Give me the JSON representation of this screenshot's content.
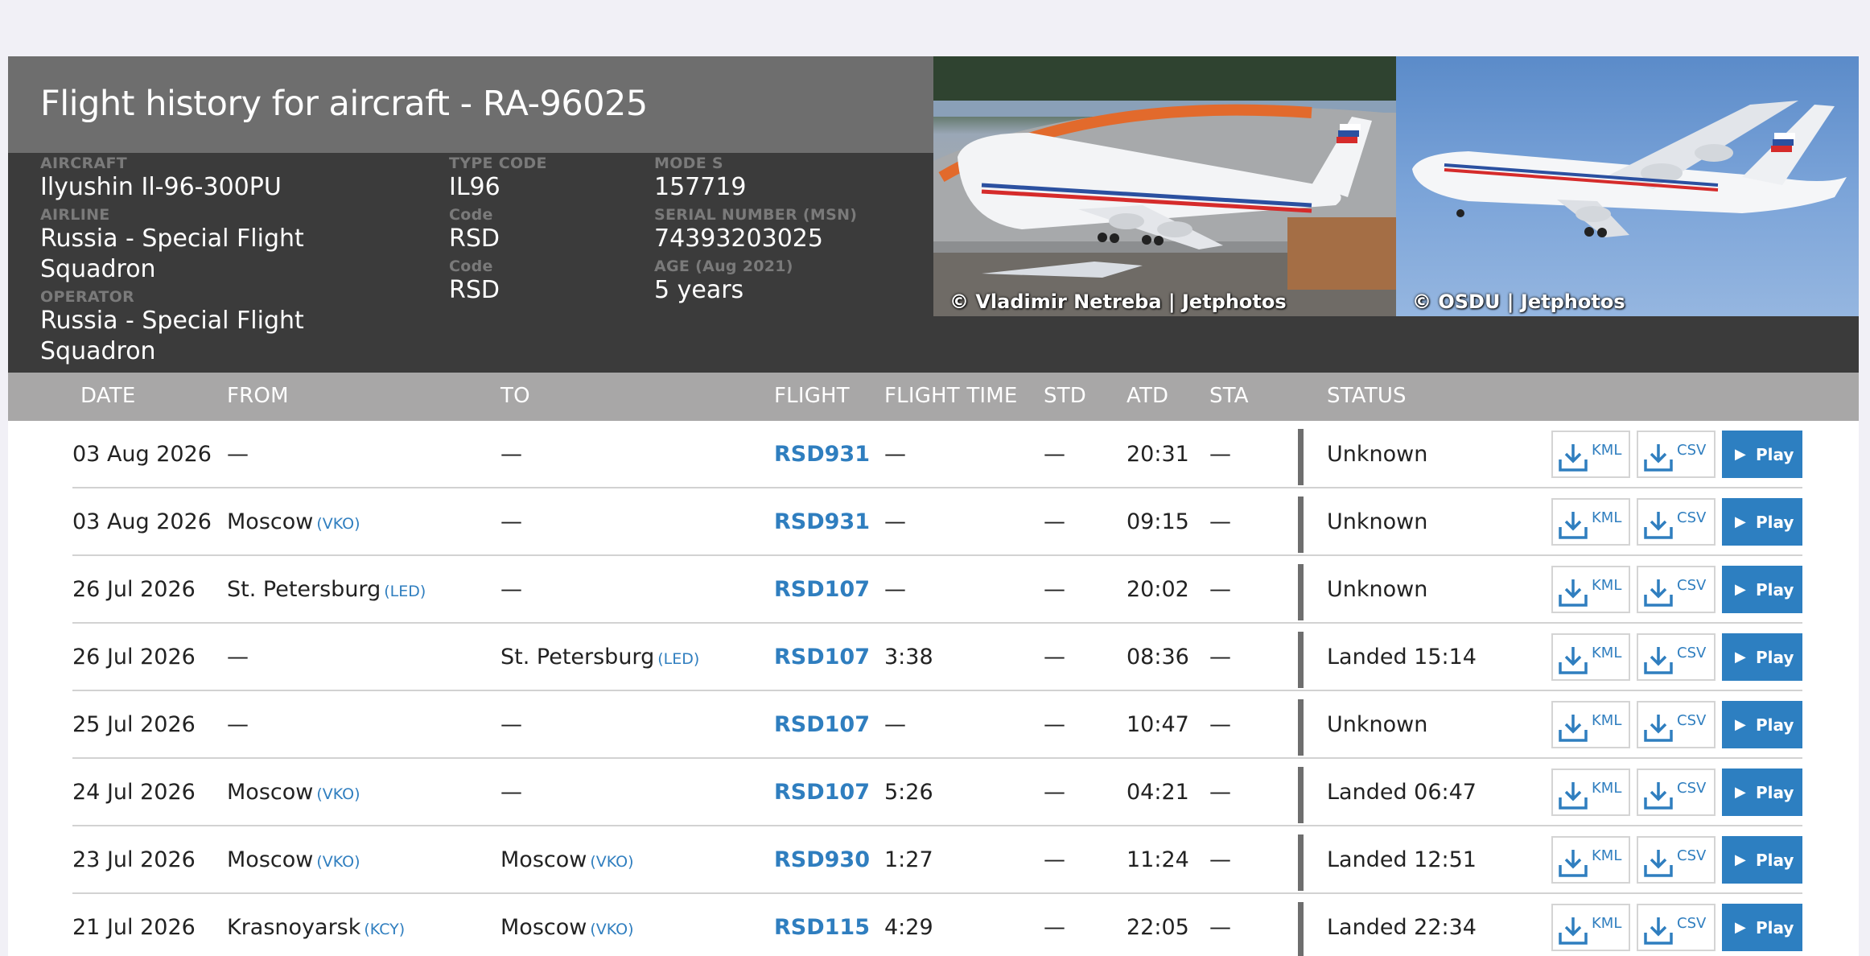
{
  "header": {
    "title": "Flight history for aircraft - RA-96025",
    "aircraft_label": "AIRCRAFT",
    "aircraft": "Ilyushin Il-96-300PU",
    "airline_label": "AIRLINE",
    "airline": "Russia - Special Flight Squadron",
    "operator_label": "OPERATOR",
    "operator": "Russia - Special Flight Squadron",
    "type_code_label": "TYPE CODE",
    "type_code": "IL96",
    "code_label_1": "Code",
    "code_1": "RSD",
    "code_label_2": "Code",
    "code_2": "RSD",
    "mode_s_label": "MODE S",
    "mode_s": "157719",
    "serial_label": "SERIAL NUMBER (MSN)",
    "serial": "74393203025",
    "age_label": "AGE (Aug 2021)",
    "age": "5 years",
    "photo1_credit": "© Vladimir Netreba | Jetphotos",
    "photo2_credit": "© OSDU | Jetphotos"
  },
  "columns": {
    "date": "DATE",
    "from": "FROM",
    "to": "TO",
    "flight": "FLIGHT",
    "flight_time": "FLIGHT TIME",
    "std": "STD",
    "atd": "ATD",
    "sta": "STA",
    "status": "STATUS"
  },
  "buttons": {
    "kml": "KML",
    "csv": "CSV",
    "play": "Play",
    "play_glyph": "▶"
  },
  "colors": {
    "accent": "#2d7fc1",
    "header_bg": "#3b3b3b",
    "title_bg": "#6e6e6e",
    "table_header_bg": "#a8a7a7"
  },
  "rows": [
    {
      "date": "03 Aug 2026",
      "from": "—",
      "from_code": "",
      "to": "—",
      "to_code": "",
      "flight": "RSD931",
      "flight_time": "—",
      "std": "—",
      "atd": "20:31",
      "sta": "—",
      "status": "Unknown"
    },
    {
      "date": "03 Aug 2026",
      "from": "Moscow",
      "from_code": "(VKO)",
      "to": "—",
      "to_code": "",
      "flight": "RSD931",
      "flight_time": "—",
      "std": "—",
      "atd": "09:15",
      "sta": "—",
      "status": "Unknown"
    },
    {
      "date": "26 Jul 2026",
      "from": "St. Petersburg",
      "from_code": "(LED)",
      "to": "—",
      "to_code": "",
      "flight": "RSD107",
      "flight_time": "—",
      "std": "—",
      "atd": "20:02",
      "sta": "—",
      "status": "Unknown"
    },
    {
      "date": "26 Jul 2026",
      "from": "—",
      "from_code": "",
      "to": "St. Petersburg",
      "to_code": "(LED)",
      "flight": "RSD107",
      "flight_time": "3:38",
      "std": "—",
      "atd": "08:36",
      "sta": "—",
      "status": "Landed 15:14"
    },
    {
      "date": "25 Jul 2026",
      "from": "—",
      "from_code": "",
      "to": "—",
      "to_code": "",
      "flight": "RSD107",
      "flight_time": "—",
      "std": "—",
      "atd": "10:47",
      "sta": "—",
      "status": "Unknown"
    },
    {
      "date": "24 Jul 2026",
      "from": "Moscow",
      "from_code": "(VKO)",
      "to": "—",
      "to_code": "",
      "flight": "RSD107",
      "flight_time": "5:26",
      "std": "—",
      "atd": "04:21",
      "sta": "—",
      "status": "Landed 06:47"
    },
    {
      "date": "23 Jul 2026",
      "from": "Moscow",
      "from_code": "(VKO)",
      "to": "Moscow",
      "to_code": "(VKO)",
      "flight": "RSD930",
      "flight_time": "1:27",
      "std": "—",
      "atd": "11:24",
      "sta": "—",
      "status": "Landed 12:51"
    },
    {
      "date": "21 Jul 2026",
      "from": "Krasnoyarsk",
      "from_code": "(KCY)",
      "to": "Moscow",
      "to_code": "(VKO)",
      "flight": "RSD115",
      "flight_time": "4:29",
      "std": "—",
      "atd": "22:05",
      "sta": "—",
      "status": "Landed 22:34"
    }
  ]
}
